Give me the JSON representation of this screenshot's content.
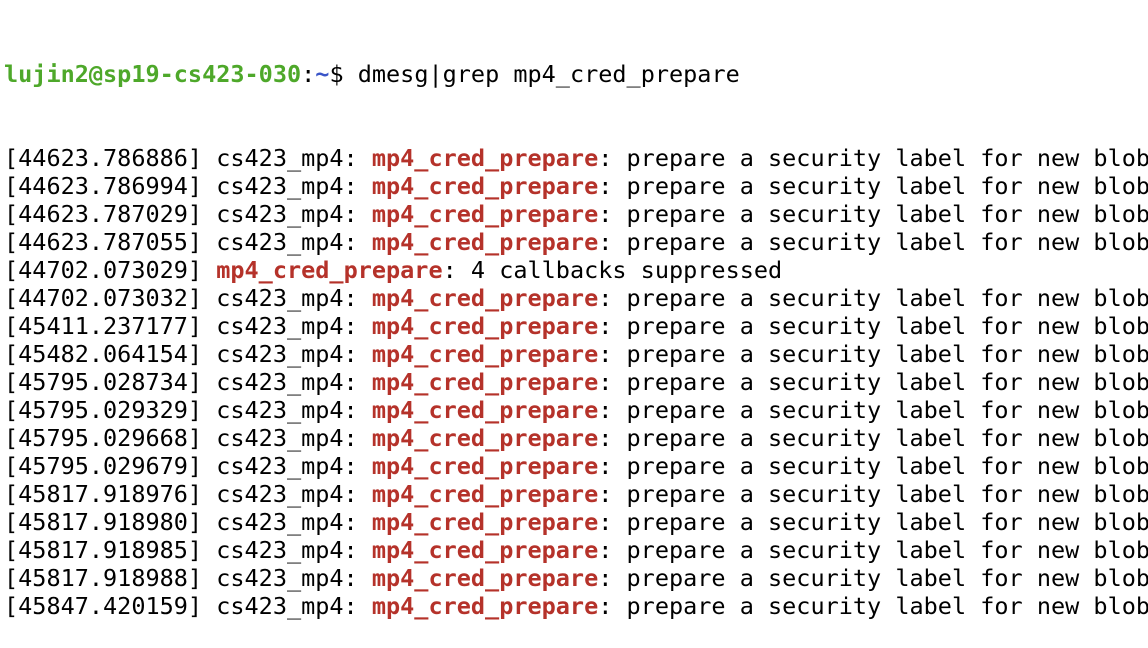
{
  "prompt": {
    "user_host": "lujin2@sp19-cs423-030",
    "separator": ":",
    "path": "~",
    "symbol": "$ ",
    "command": "dmesg|grep mp4_cred_prepare"
  },
  "colors": {
    "prompt_user": "#4ea82a",
    "prompt_path": "#3a55c8",
    "grep_match": "#b5322a",
    "text": "#000000",
    "background": "#ffffff"
  },
  "lines": [
    {
      "ts": "[44623.786886]",
      "mod": " cs423_mp4: ",
      "match": "mp4_cred_prepare",
      "rest": ": prepare a security label for new blob"
    },
    {
      "ts": "[44623.786994]",
      "mod": " cs423_mp4: ",
      "match": "mp4_cred_prepare",
      "rest": ": prepare a security label for new blob"
    },
    {
      "ts": "[44623.787029]",
      "mod": " cs423_mp4: ",
      "match": "mp4_cred_prepare",
      "rest": ": prepare a security label for new blob"
    },
    {
      "ts": "[44623.787055]",
      "mod": " cs423_mp4: ",
      "match": "mp4_cred_prepare",
      "rest": ": prepare a security label for new blob"
    },
    {
      "ts": "[44702.073029]",
      "mod": " ",
      "match": "mp4_cred_prepare",
      "rest": ": 4 callbacks suppressed"
    },
    {
      "ts": "[44702.073032]",
      "mod": " cs423_mp4: ",
      "match": "mp4_cred_prepare",
      "rest": ": prepare a security label for new blob"
    },
    {
      "ts": "[45411.237177]",
      "mod": " cs423_mp4: ",
      "match": "mp4_cred_prepare",
      "rest": ": prepare a security label for new blob"
    },
    {
      "ts": "[45482.064154]",
      "mod": " cs423_mp4: ",
      "match": "mp4_cred_prepare",
      "rest": ": prepare a security label for new blob"
    },
    {
      "ts": "[45795.028734]",
      "mod": " cs423_mp4: ",
      "match": "mp4_cred_prepare",
      "rest": ": prepare a security label for new blob"
    },
    {
      "ts": "[45795.029329]",
      "mod": " cs423_mp4: ",
      "match": "mp4_cred_prepare",
      "rest": ": prepare a security label for new blob"
    },
    {
      "ts": "[45795.029668]",
      "mod": " cs423_mp4: ",
      "match": "mp4_cred_prepare",
      "rest": ": prepare a security label for new blob"
    },
    {
      "ts": "[45795.029679]",
      "mod": " cs423_mp4: ",
      "match": "mp4_cred_prepare",
      "rest": ": prepare a security label for new blob"
    },
    {
      "ts": "[45817.918976]",
      "mod": " cs423_mp4: ",
      "match": "mp4_cred_prepare",
      "rest": ": prepare a security label for new blob"
    },
    {
      "ts": "[45817.918980]",
      "mod": " cs423_mp4: ",
      "match": "mp4_cred_prepare",
      "rest": ": prepare a security label for new blob"
    },
    {
      "ts": "[45817.918985]",
      "mod": " cs423_mp4: ",
      "match": "mp4_cred_prepare",
      "rest": ": prepare a security label for new blob"
    },
    {
      "ts": "[45817.918988]",
      "mod": " cs423_mp4: ",
      "match": "mp4_cred_prepare",
      "rest": ": prepare a security label for new blob"
    },
    {
      "ts": "[45847.420159]",
      "mod": " cs423_mp4: ",
      "match": "mp4_cred_prepare",
      "rest": ": prepare a security label for new blob"
    }
  ]
}
